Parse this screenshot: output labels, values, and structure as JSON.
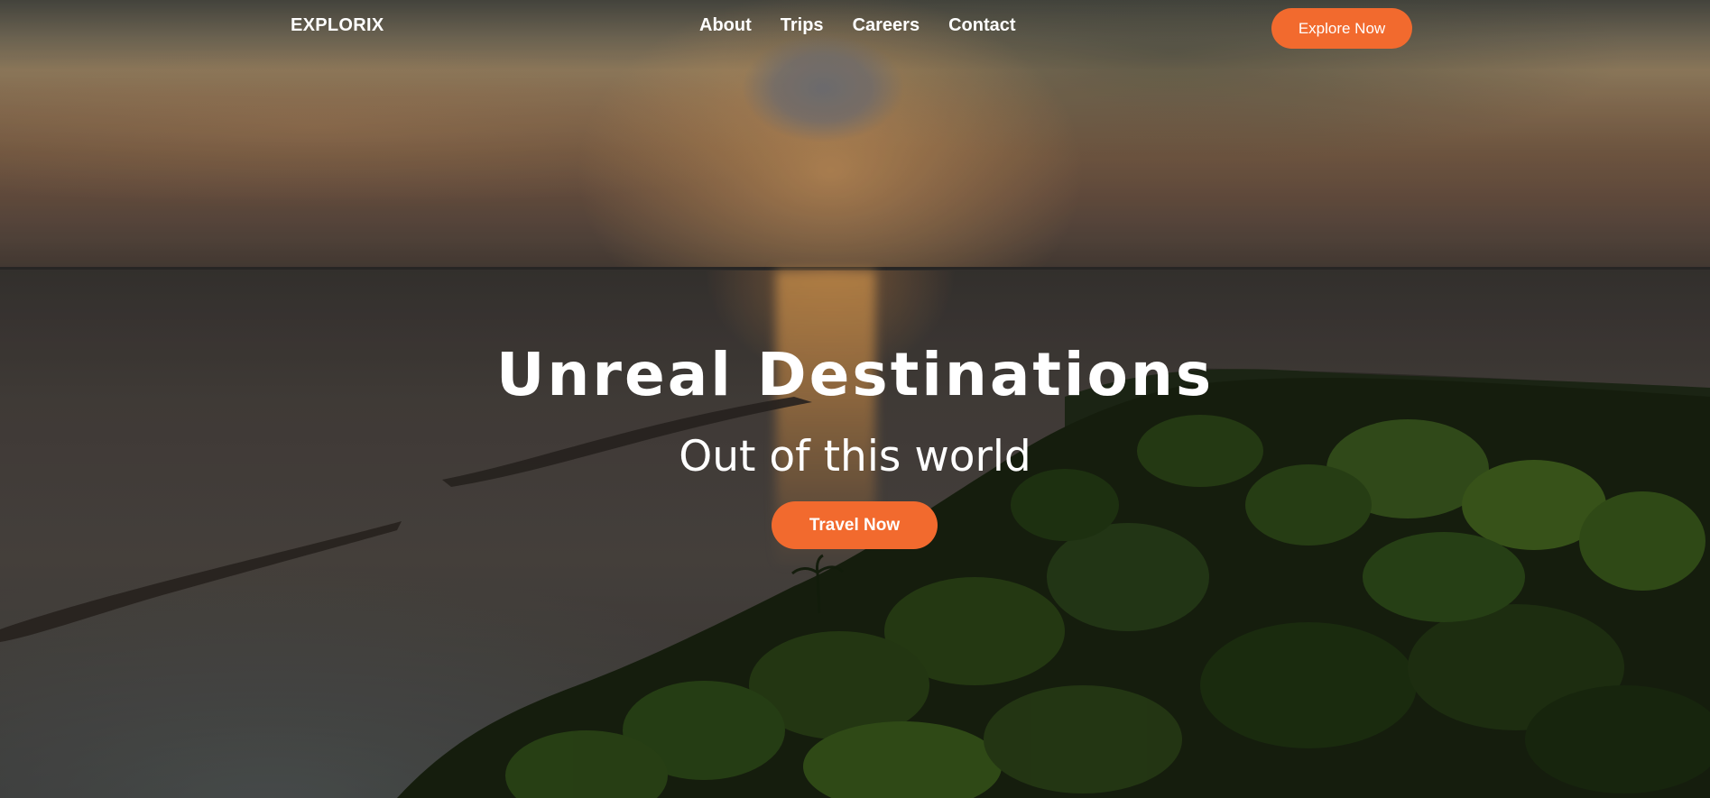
{
  "brand": {
    "name": "EXPLORIX"
  },
  "nav": {
    "items": [
      {
        "label": "About"
      },
      {
        "label": "Trips"
      },
      {
        "label": "Careers"
      },
      {
        "label": "Contact"
      }
    ],
    "cta_label": "Explore Now"
  },
  "hero": {
    "title": "Unreal Destinations",
    "subtitle": "Out of this world",
    "cta_label": "Travel Now",
    "background_description_icon": "sunset-island-photo"
  },
  "colors": {
    "accent": "#f26a2e",
    "text": "#ffffff"
  }
}
